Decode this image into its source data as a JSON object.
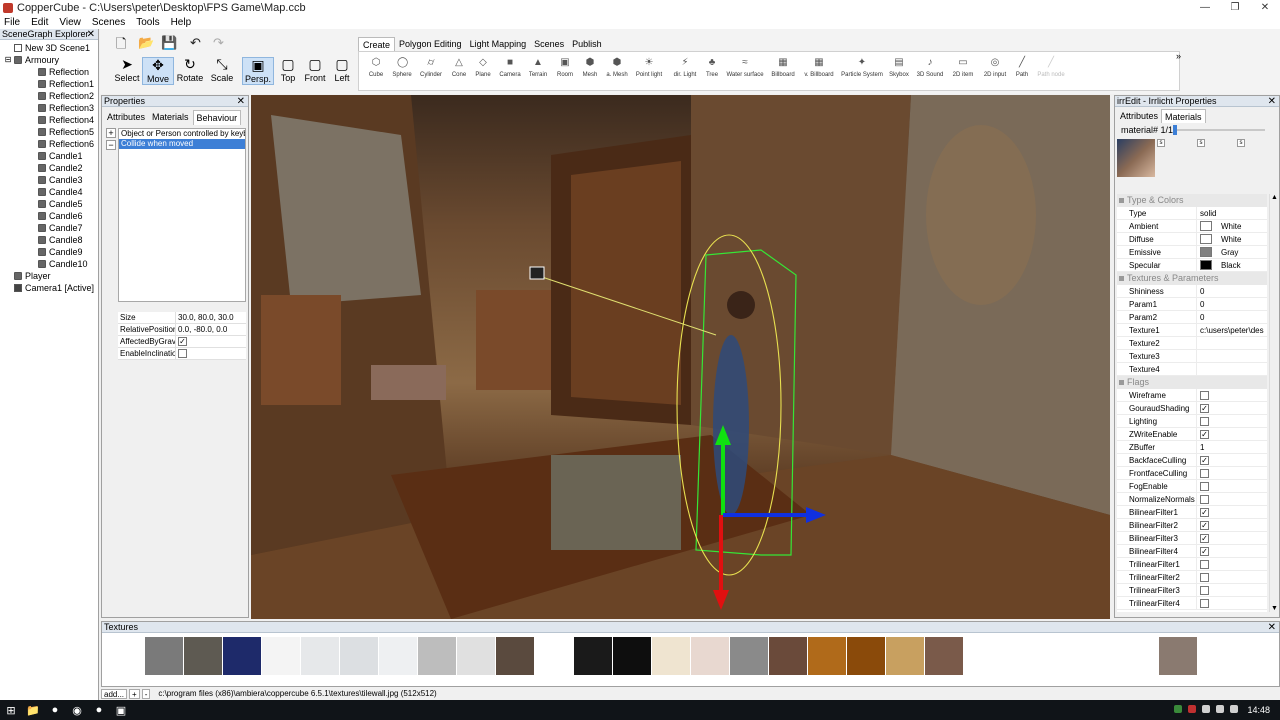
{
  "window": {
    "title": "CopperCube - C:\\Users\\peter\\Desktop\\FPS Game\\Map.ccb",
    "minimize": "—",
    "maximize": "❐",
    "close": "✕"
  },
  "menu": [
    "File",
    "Edit",
    "View",
    "Scenes",
    "Tools",
    "Help"
  ],
  "scenegraph": {
    "title": "SceneGraph Explorer",
    "close": "✕",
    "items": [
      {
        "label": "New 3D Scene1",
        "indent": 0,
        "icon": "scene",
        "expander": ""
      },
      {
        "label": "Armoury",
        "indent": 0,
        "icon": "mesh",
        "expander": "⊟"
      },
      {
        "label": "Reflection",
        "indent": 1,
        "icon": "mesh",
        "expander": ""
      },
      {
        "label": "Reflection1",
        "indent": 1,
        "icon": "mesh",
        "expander": ""
      },
      {
        "label": "Reflection2",
        "indent": 1,
        "icon": "mesh",
        "expander": ""
      },
      {
        "label": "Reflection3",
        "indent": 1,
        "icon": "mesh",
        "expander": ""
      },
      {
        "label": "Reflection4",
        "indent": 1,
        "icon": "mesh",
        "expander": ""
      },
      {
        "label": "Reflection5",
        "indent": 1,
        "icon": "mesh",
        "expander": ""
      },
      {
        "label": "Reflection6",
        "indent": 1,
        "icon": "mesh",
        "expander": ""
      },
      {
        "label": "Candle1",
        "indent": 1,
        "icon": "mesh",
        "expander": ""
      },
      {
        "label": "Candle2",
        "indent": 1,
        "icon": "mesh",
        "expander": ""
      },
      {
        "label": "Candle3",
        "indent": 1,
        "icon": "mesh",
        "expander": ""
      },
      {
        "label": "Candle4",
        "indent": 1,
        "icon": "mesh",
        "expander": ""
      },
      {
        "label": "Candle5",
        "indent": 1,
        "icon": "mesh",
        "expander": ""
      },
      {
        "label": "Candle6",
        "indent": 1,
        "icon": "mesh",
        "expander": ""
      },
      {
        "label": "Candle7",
        "indent": 1,
        "icon": "mesh",
        "expander": ""
      },
      {
        "label": "Candle8",
        "indent": 1,
        "icon": "mesh",
        "expander": ""
      },
      {
        "label": "Candle9",
        "indent": 1,
        "icon": "mesh",
        "expander": ""
      },
      {
        "label": "Candle10",
        "indent": 1,
        "icon": "mesh",
        "expander": ""
      },
      {
        "label": "Player",
        "indent": 0,
        "icon": "mesh",
        "expander": ""
      },
      {
        "label": "Camera1 [Active]",
        "indent": 0,
        "icon": "cam",
        "expander": ""
      }
    ]
  },
  "toolbar": {
    "file_icons": [
      "new-icon",
      "open-icon",
      "save-icon",
      "undo-icon",
      "redo-icon"
    ],
    "tools": [
      "Select",
      "Move",
      "Rotate",
      "Scale"
    ],
    "active_tool": "Move",
    "views": [
      "Persp.",
      "Top",
      "Front",
      "Left"
    ],
    "active_view": "Persp.",
    "ribbon_tabs": [
      "Create",
      "Polygon Editing",
      "Light Mapping",
      "Scenes",
      "Publish"
    ],
    "active_ribbon_tab": "Create",
    "more": "»",
    "create_items": [
      {
        "label": "Cube",
        "glyph": "⬡"
      },
      {
        "label": "Sphere",
        "glyph": "◯"
      },
      {
        "label": "Cylinder",
        "glyph": "⌭"
      },
      {
        "label": "Cone",
        "glyph": "△"
      },
      {
        "label": "Plane",
        "glyph": "◇"
      },
      {
        "label": "Camera",
        "glyph": "■"
      },
      {
        "label": "Terrain",
        "glyph": "▲"
      },
      {
        "label": "Room",
        "glyph": "▣"
      },
      {
        "label": "Mesh",
        "glyph": "⬢"
      },
      {
        "label": "a. Mesh",
        "glyph": "⬢"
      },
      {
        "label": "Point light",
        "glyph": "☀"
      },
      {
        "label": "dir. Light",
        "glyph": "⚡"
      },
      {
        "label": "Tree",
        "glyph": "♣"
      },
      {
        "label": "Water surface",
        "glyph": "≈"
      },
      {
        "label": "Billboard",
        "glyph": "▦"
      },
      {
        "label": "v. Billboard",
        "glyph": "▦"
      },
      {
        "label": "Particle System",
        "glyph": "✦"
      },
      {
        "label": "Skybox",
        "glyph": "▤"
      },
      {
        "label": "3D Sound",
        "glyph": "♪"
      },
      {
        "label": "2D item",
        "glyph": "▭"
      },
      {
        "label": "2D input",
        "glyph": "◎"
      },
      {
        "label": "Path",
        "glyph": "╱"
      },
      {
        "label": "Path node",
        "glyph": "╱"
      }
    ]
  },
  "properties": {
    "title": "Properties",
    "close": "✕",
    "tabs": [
      "Attributes",
      "Materials",
      "Behaviour"
    ],
    "active_tab": "Behaviour",
    "add_btn": "+",
    "remove_btn": "−",
    "behaviours": [
      "Object or Person controlled by keyboard",
      "Collide when moved"
    ],
    "selected_behaviour": 1,
    "attributes": [
      {
        "key": "Size",
        "value": "30.0, 80.0, 30.0",
        "type": "text"
      },
      {
        "key": "RelativePosition",
        "value": "0.0, -80.0, 0.0",
        "type": "text"
      },
      {
        "key": "AffectedByGravity",
        "value": "✓",
        "type": "check"
      },
      {
        "key": "EnableInclination",
        "value": "",
        "type": "check"
      }
    ]
  },
  "irredit": {
    "title": "irrEdit - Irrlicht Properties",
    "close": "✕",
    "tabs": [
      "Attributes",
      "Materials"
    ],
    "active_tab": "Materials",
    "material_label": "material# 1/1",
    "material_index": 1,
    "material_count": 1,
    "thumb_s": "s",
    "sections": [
      {
        "title": "Type & Colors",
        "rows": [
          {
            "key": "Type",
            "value": "solid",
            "kind": "text"
          },
          {
            "key": "Ambient",
            "value": "White",
            "kind": "color",
            "color": "#ffffff"
          },
          {
            "key": "Diffuse",
            "value": "White",
            "kind": "color",
            "color": "#ffffff"
          },
          {
            "key": "Emissive",
            "value": "Gray",
            "kind": "color",
            "color": "#808080"
          },
          {
            "key": "Specular",
            "value": "Black",
            "kind": "color",
            "color": "#000000"
          }
        ]
      },
      {
        "title": "Textures & Parameters",
        "rows": [
          {
            "key": "Shininess",
            "value": "0",
            "kind": "text"
          },
          {
            "key": "Param1",
            "value": "0",
            "kind": "text"
          },
          {
            "key": "Param2",
            "value": "0",
            "kind": "text"
          },
          {
            "key": "Texture1",
            "value": "c:\\users\\peter\\des",
            "kind": "text"
          },
          {
            "key": "Texture2",
            "value": "",
            "kind": "text"
          },
          {
            "key": "Texture3",
            "value": "",
            "kind": "text"
          },
          {
            "key": "Texture4",
            "value": "",
            "kind": "text"
          }
        ]
      },
      {
        "title": "Flags",
        "rows": [
          {
            "key": "Wireframe",
            "value": "",
            "kind": "check"
          },
          {
            "key": "GouraudShading",
            "value": "✓",
            "kind": "check"
          },
          {
            "key": "Lighting",
            "value": "",
            "kind": "check"
          },
          {
            "key": "ZWriteEnable",
            "value": "✓",
            "kind": "check"
          },
          {
            "key": "ZBuffer",
            "value": "1",
            "kind": "text"
          },
          {
            "key": "BackfaceCulling",
            "value": "✓",
            "kind": "check"
          },
          {
            "key": "FrontfaceCulling",
            "value": "",
            "kind": "check"
          },
          {
            "key": "FogEnable",
            "value": "",
            "kind": "check"
          },
          {
            "key": "NormalizeNormals",
            "value": "",
            "kind": "check"
          },
          {
            "key": "BilinearFilter1",
            "value": "✓",
            "kind": "check"
          },
          {
            "key": "BilinearFilter2",
            "value": "✓",
            "kind": "check"
          },
          {
            "key": "BilinearFilter3",
            "value": "✓",
            "kind": "check"
          },
          {
            "key": "BilinearFilter4",
            "value": "✓",
            "kind": "check"
          },
          {
            "key": "TrilinearFilter1",
            "value": "",
            "kind": "check"
          },
          {
            "key": "TrilinearFilter2",
            "value": "",
            "kind": "check"
          },
          {
            "key": "TrilinearFilter3",
            "value": "",
            "kind": "check"
          },
          {
            "key": "TrilinearFilter4",
            "value": "",
            "kind": "check"
          }
        ]
      }
    ]
  },
  "textures": {
    "title": "Textures",
    "close": "✕",
    "swatches": [
      "#7a7a7a",
      "#5e5a52",
      "#1e2a6a",
      "#f4f4f4",
      "#e6e8ea",
      "#dcdfe2",
      "#eef0f2",
      "#bdbdbd",
      "#e0e0e0",
      "#5a4a3e",
      "#ffffff",
      "#1a1a1a",
      "#0e0e0e",
      "#efe4d0",
      "#e8d8d0",
      "#8a8a8a",
      "#6a4a3a",
      "#b06a1a",
      "#8a4a0a",
      "#c8a060",
      "#7a5a4a",
      "#ffffff",
      "#ffffff",
      "#ffffff",
      "#ffffff",
      "#ffffff",
      "#8a7a70",
      "#ffffff"
    ]
  },
  "status": {
    "add": "add...",
    "plus": "+",
    "minus": "-",
    "path": "c:\\program files (x86)\\ambiera\\coppercube 6.5.1\\textures\\tilewall.jpg (512x512)"
  },
  "taskbar": {
    "clock": "14:48"
  }
}
